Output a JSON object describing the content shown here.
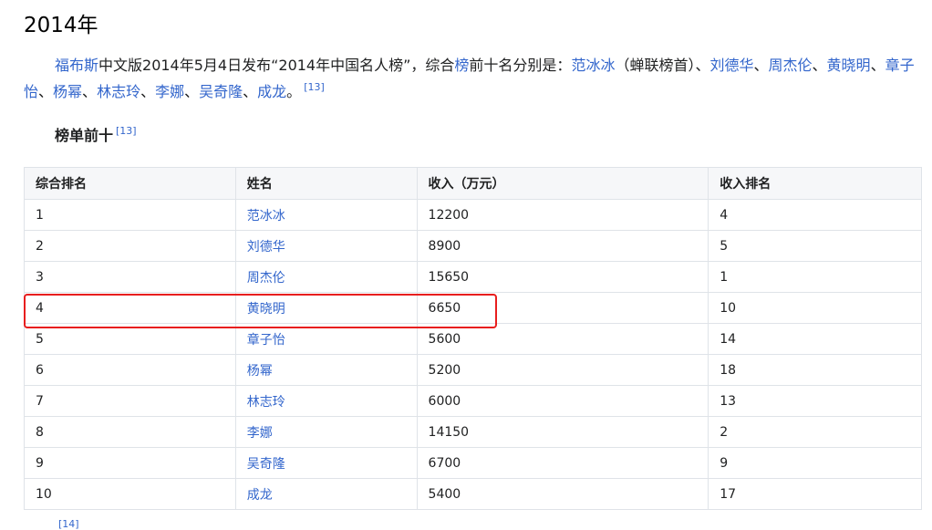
{
  "section": {
    "title": "2014年"
  },
  "intro": {
    "link_forbes": "福布斯",
    "text1": "中文版2014年5月4日发布“2014年中国名人榜”，综合",
    "link_bang": "榜",
    "text2": "前十名分别是：",
    "names": [
      "范冰冰",
      "刘德华",
      "周杰伦",
      "黄晓明",
      "章子怡",
      "杨幂",
      "林志玲",
      "李娜",
      "吴奇隆",
      "成龙"
    ],
    "note_first": "（蝉联榜首）",
    "sep": "、",
    "end": "。",
    "ref": "[13]"
  },
  "subsection": {
    "title": "榜单前十",
    "ref": "[13]"
  },
  "table": {
    "headers": [
      "综合排名",
      "姓名",
      "收入（万元）",
      "收入排名"
    ],
    "rows": [
      {
        "rank": "1",
        "name": "范冰冰",
        "income": "12200",
        "income_rank": "4"
      },
      {
        "rank": "2",
        "name": "刘德华",
        "income": "8900",
        "income_rank": "5"
      },
      {
        "rank": "3",
        "name": "周杰伦",
        "income": "15650",
        "income_rank": "1"
      },
      {
        "rank": "4",
        "name": "黄晓明",
        "income": "6650",
        "income_rank": "10"
      },
      {
        "rank": "5",
        "name": "章子怡",
        "income": "5600",
        "income_rank": "14"
      },
      {
        "rank": "6",
        "name": "杨幂",
        "income": "5200",
        "income_rank": "18"
      },
      {
        "rank": "7",
        "name": "林志玲",
        "income": "6000",
        "income_rank": "13"
      },
      {
        "rank": "8",
        "name": "李娜",
        "income": "14150",
        "income_rank": "2"
      },
      {
        "rank": "9",
        "name": "吴奇隆",
        "income": "6700",
        "income_rank": "9"
      },
      {
        "rank": "10",
        "name": "成龙",
        "income": "5400",
        "income_rank": "17"
      }
    ]
  },
  "footer": {
    "ref": "[14]"
  },
  "colors": {
    "link": "#3366cc",
    "highlight": "#e81e1e",
    "header_bg": "#f6f7f9",
    "border": "#dfe3e8"
  }
}
